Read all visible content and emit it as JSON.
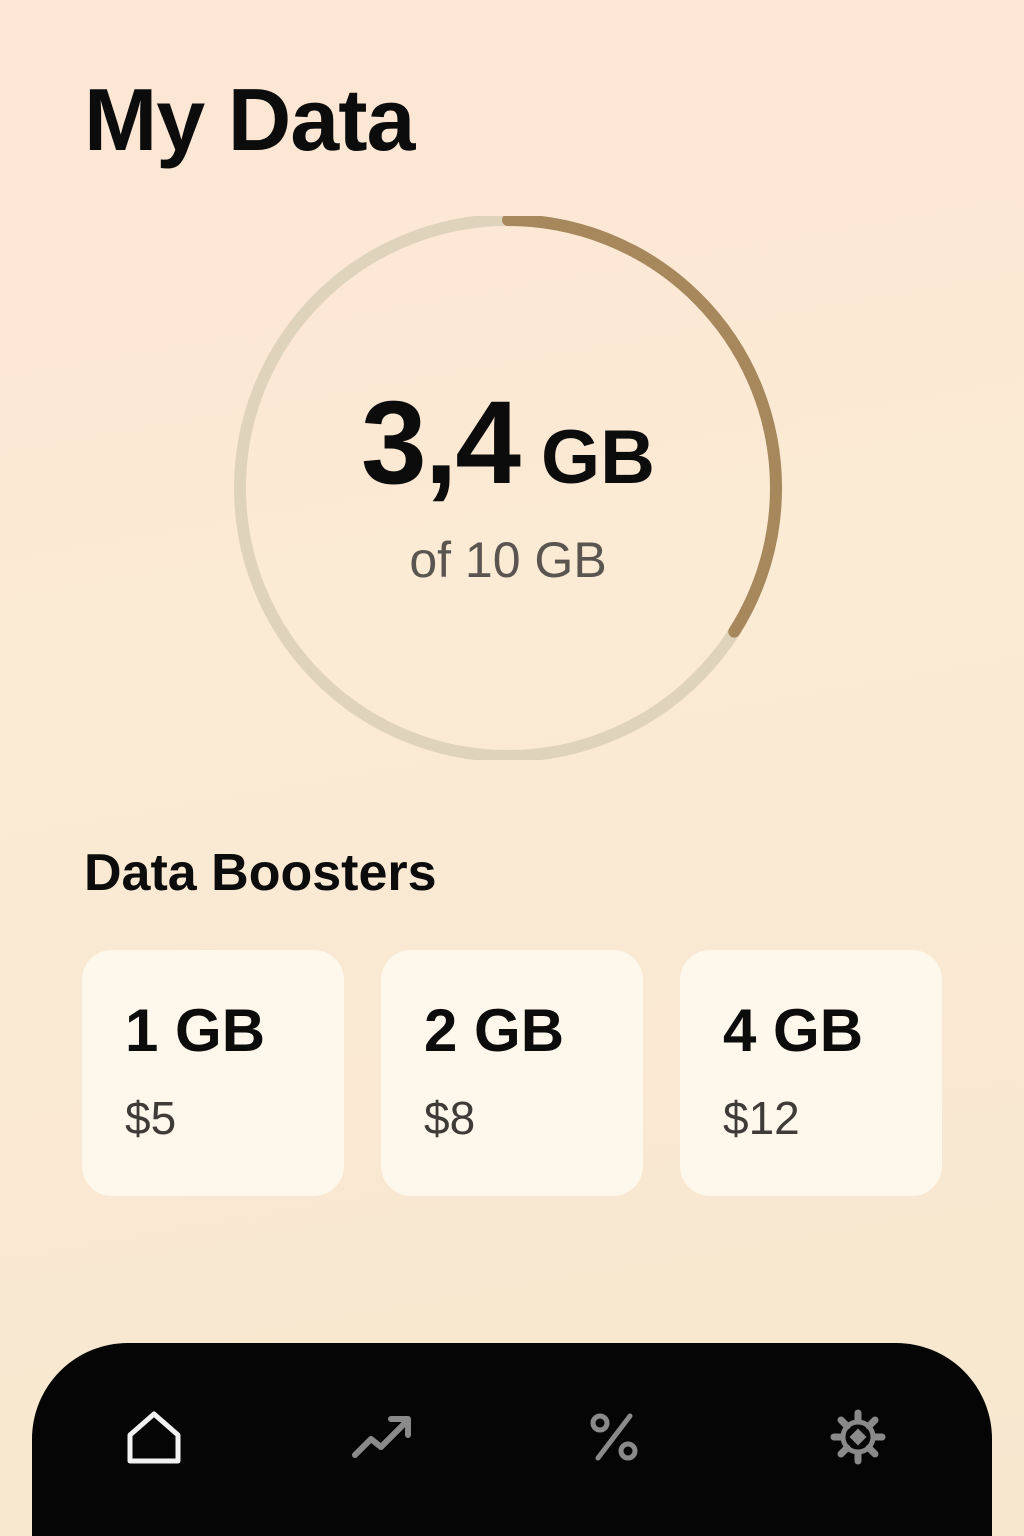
{
  "header": {
    "title": "My Data"
  },
  "usage": {
    "used_value": "3,4",
    "used_unit": "GB",
    "total_label": "of 10 GB",
    "used_fraction": 0.34,
    "ring_color": "#a6885c",
    "track_color": "#e0d3bb"
  },
  "boosters": {
    "title": "Data Boosters",
    "items": [
      {
        "size": "1 GB",
        "price": "$5"
      },
      {
        "size": "2 GB",
        "price": "$8"
      },
      {
        "size": "4 GB",
        "price": "$12"
      }
    ]
  },
  "nav": {
    "items": [
      {
        "icon": "home-icon",
        "active": true
      },
      {
        "icon": "trending-up-icon",
        "active": false
      },
      {
        "icon": "percent-icon",
        "active": false
      },
      {
        "icon": "settings-gear-icon",
        "active": false
      }
    ]
  }
}
